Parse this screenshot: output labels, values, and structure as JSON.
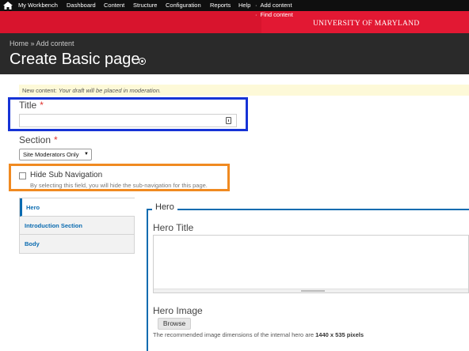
{
  "admin_bar": {
    "items": [
      "My Workbench",
      "Dashboard",
      "Content",
      "Structure",
      "Configuration",
      "Reports",
      "Help",
      "Add content"
    ],
    "sub_items": [
      "Find content"
    ]
  },
  "brand": {
    "name": "UNIVERSITY OF MARYLAND",
    "color": "#e21833"
  },
  "header": {
    "breadcrumb": "Home » Add content",
    "title": "Create Basic page"
  },
  "notice": {
    "prefix": "New content: ",
    "message": "Your draft will be placed in moderation."
  },
  "form": {
    "title_label": "Title",
    "required_marker": "*",
    "title_value": "",
    "section_label": "Section",
    "section_selected": "Site Moderators Only",
    "hide_sub_nav_label": "Hide Sub Navigation",
    "hide_sub_nav_checked": false,
    "hide_sub_nav_description": "By selecting this field, you will hide the sub-navigation for this page."
  },
  "vertical_tabs": [
    {
      "label": "Hero",
      "active": true
    },
    {
      "label": "Introduction Section",
      "active": false
    },
    {
      "label": "Body",
      "active": false
    }
  ],
  "hero": {
    "legend": "Hero",
    "title_label": "Hero Title",
    "title_value": "",
    "image_label": "Hero Image",
    "browse_label": "Browse",
    "description_prefix": "The recommended image dimensions of the internal hero are ",
    "description_dims": "1440 x 535 pixels"
  },
  "colors": {
    "highlight_blue": "#1633d6",
    "highlight_orange": "#f08a21",
    "tab_accent": "#0a6bb0"
  }
}
